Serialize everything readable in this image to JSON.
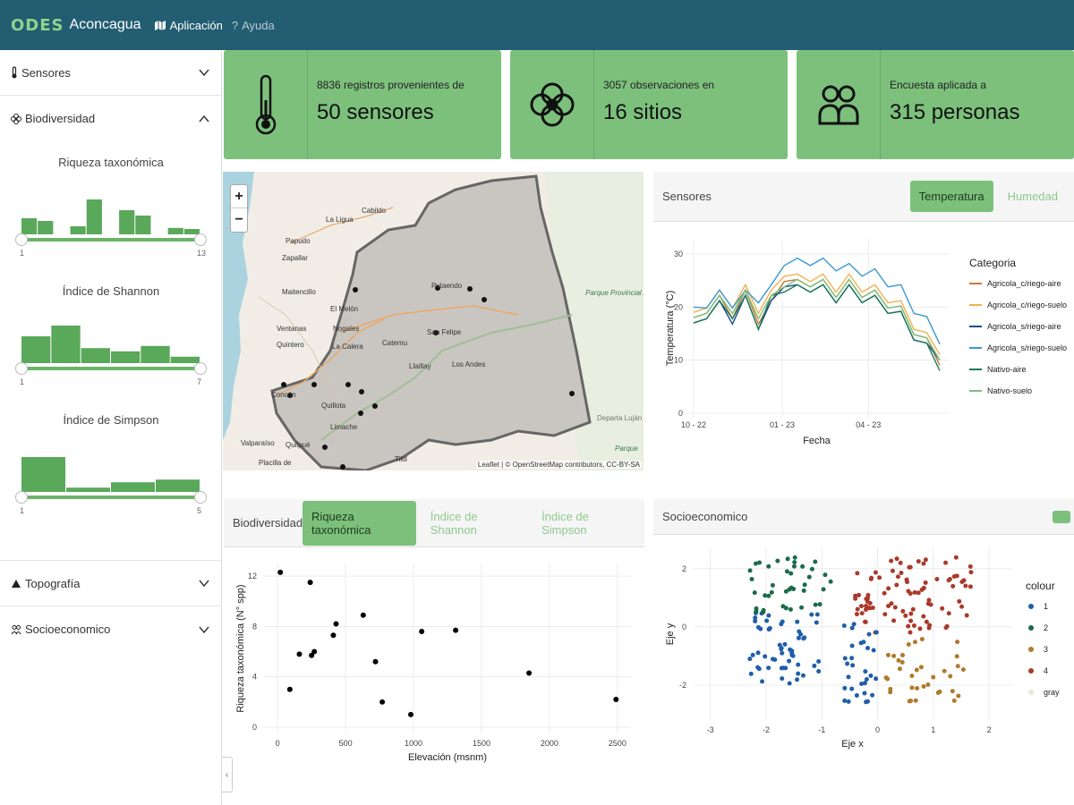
{
  "navbar": {
    "logo": "ODES",
    "brand": "Aconcagua",
    "links": [
      {
        "label": "Aplicación",
        "icon": "map-icon"
      },
      {
        "label": "Ayuda",
        "icon": "question-icon"
      }
    ],
    "colors": {
      "bar": "#235d72",
      "logo": "#8fd48a"
    }
  },
  "sidebar": {
    "sections": [
      {
        "label": "Sensores",
        "icon": "thermometer-icon",
        "expanded": false
      },
      {
        "label": "Biodiversidad",
        "icon": "flower-icon",
        "expanded": true
      },
      {
        "label": "Topografía",
        "icon": "mountain-icon",
        "expanded": false
      },
      {
        "label": "Socioeconomico",
        "icon": "people-icon",
        "expanded": false
      }
    ],
    "filters": [
      {
        "title": "Riqueza taxonómica",
        "min": "1",
        "max": "13",
        "bars": [
          0.3,
          0.25,
          0,
          0.15,
          0.65,
          0,
          0.45,
          0.35,
          0,
          0.12,
          0.1
        ]
      },
      {
        "title": "Índice de Shannon",
        "min": "1",
        "max": "7",
        "bars": [
          0.5,
          0.7,
          0.28,
          0.22,
          0.32,
          0.12
        ]
      },
      {
        "title": "Índice de Simpson",
        "min": "1",
        "max": "5",
        "bars": [
          0.65,
          0.08,
          0.18,
          0.23
        ]
      }
    ]
  },
  "cards": [
    {
      "small": "8836 registros provenientes de",
      "big": "50 sensores",
      "icon": "thermometer-icon"
    },
    {
      "small": "3057 observaciones en",
      "big": "16 sitios",
      "icon": "flower-icon"
    },
    {
      "small": "Encuesta aplicada a",
      "big": "315 personas",
      "icon": "users-icon"
    }
  ],
  "map": {
    "zoom_in": "+",
    "zoom_out": "−",
    "attribution": "Leaflet | © OpenStreetMap contributors, CC-BY-SA",
    "places": [
      "La Ligua",
      "Cabildo",
      "Papudo",
      "Zapallar",
      "Maitencillo",
      "El Melón",
      "Nogales",
      "Ventanas",
      "Quintero",
      "La Calera",
      "Catemu",
      "Putaendo",
      "San Felipe",
      "Los Andes",
      "Llaillay",
      "Quillota",
      "Limache",
      "Concón",
      "Valparaíso",
      "Quilpué",
      "Placilla de",
      "Tiltil",
      "Parque Provincial Aconcagua",
      "Departa Luján Cuy",
      "Parque"
    ]
  },
  "sensores_panel": {
    "title": "Sensores",
    "tabs": [
      "Temperatura",
      "Humedad"
    ],
    "active_tab": 0
  },
  "biodiversidad_panel": {
    "title": "Biodiversidad",
    "tabs": [
      "Riqueza taxonómica",
      "Índice de Shannon",
      "Índice de Simpson"
    ],
    "active_tab": 0
  },
  "socio_panel": {
    "title": "Socioeconomico"
  },
  "chart_data": [
    {
      "type": "line",
      "xlabel": "Fecha",
      "ylabel": "Temperatura (°C)",
      "x_ticks": [
        "10 - 22",
        "01 - 23",
        "04 - 23"
      ],
      "y_ticks": [
        0,
        10,
        20,
        30
      ],
      "ylim": [
        0,
        32
      ],
      "legend_title": "Categoria",
      "legend_position": "right",
      "series": [
        {
          "name": "Agricola_c/riego-aire",
          "color": "#c8773a",
          "values": [
            18,
            20,
            21,
            19,
            22,
            18,
            20,
            26,
            24,
            25,
            24,
            23,
            24,
            23,
            22,
            21,
            19,
            16,
            13,
            9
          ]
        },
        {
          "name": "Agricola_c/riego-suelo",
          "color": "#f2b04f",
          "values": [
            19,
            21,
            22,
            21,
            23,
            20,
            22,
            27,
            25,
            26,
            25,
            24,
            25,
            24,
            23,
            22,
            20,
            17,
            14,
            11
          ]
        },
        {
          "name": "Agricola_s/riego-aire",
          "color": "#1a4f8a",
          "values": [
            17,
            19,
            20,
            18,
            21,
            17,
            20,
            25,
            23,
            24,
            23,
            22,
            23,
            22,
            21,
            20,
            18,
            15,
            12,
            10
          ]
        },
        {
          "name": "Agricola_s/riego-suelo",
          "color": "#3a9ad4",
          "values": [
            20,
            21,
            22,
            21,
            22,
            22,
            23,
            29,
            28,
            29,
            28,
            28,
            27,
            27,
            26,
            25,
            23,
            20,
            17,
            13
          ]
        },
        {
          "name": "Nativo-aire",
          "color": "#1b7a5a",
          "values": [
            17,
            19,
            20,
            19,
            21,
            17,
            21,
            24,
            23,
            24,
            23,
            22,
            23,
            22,
            21,
            20,
            18,
            15,
            12,
            8
          ]
        },
        {
          "name": "Nativo-suelo",
          "color": "#7cc07c",
          "values": [
            18,
            20,
            21,
            20,
            22,
            19,
            21,
            25,
            24,
            25,
            24,
            23,
            24,
            23,
            22,
            21,
            19,
            16,
            13,
            10
          ]
        }
      ]
    },
    {
      "type": "scatter",
      "xlabel": "Elevación (msnm)",
      "ylabel": "Riqueza taxonómica (N° spp)",
      "x_ticks": [
        0,
        500,
        1000,
        1500,
        2000,
        2500
      ],
      "y_ticks": [
        0,
        4,
        8,
        12
      ],
      "xlim": [
        -100,
        2600
      ],
      "ylim": [
        -0.5,
        13
      ],
      "points": [
        [
          20,
          12.3
        ],
        [
          240,
          11.5
        ],
        [
          90,
          3
        ],
        [
          160,
          5.8
        ],
        [
          250,
          5.7
        ],
        [
          270,
          6
        ],
        [
          410,
          7.3
        ],
        [
          430,
          8.2
        ],
        [
          630,
          8.9
        ],
        [
          720,
          5.2
        ],
        [
          770,
          2
        ],
        [
          980,
          1
        ],
        [
          1060,
          7.6
        ],
        [
          1310,
          7.7
        ],
        [
          1850,
          4.3
        ],
        [
          2490,
          2.2
        ]
      ]
    },
    {
      "type": "scatter",
      "xlabel": "Eje x",
      "ylabel": "Eje y",
      "x_ticks": [
        -3,
        -2,
        -1,
        0,
        1,
        2
      ],
      "y_ticks": [
        -2,
        0,
        2
      ],
      "xlim": [
        -3.3,
        2.4
      ],
      "ylim": [
        -3.2,
        2.7
      ],
      "legend_title": "colour",
      "legend_position": "right",
      "groups": [
        {
          "name": "1",
          "color": "#1f5ea8"
        },
        {
          "name": "2",
          "color": "#1a6b4a"
        },
        {
          "name": "3",
          "color": "#b07a2a"
        },
        {
          "name": "4",
          "color": "#a93a2a"
        },
        {
          "name": "gray",
          "color": "#ebe7d2"
        }
      ]
    }
  ]
}
